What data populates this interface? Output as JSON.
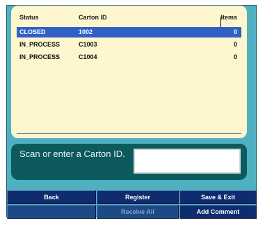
{
  "list": {
    "headers": {
      "status": "Status",
      "carton_id": "Carton ID",
      "items": "Items"
    },
    "rows": [
      {
        "status": "CLOSED",
        "carton_id": "1002",
        "items": "0",
        "selected": true
      },
      {
        "status": "IN_PROCESS",
        "carton_id": "C1003",
        "items": "0",
        "selected": false
      },
      {
        "status": "IN_PROCESS",
        "carton_id": "C1004",
        "items": "0",
        "selected": false
      }
    ]
  },
  "scan": {
    "prompt": "Scan or enter a Carton ID.",
    "value": ""
  },
  "buttons": {
    "back": "Back",
    "register": "Register",
    "save_exit": "Save & Exit",
    "receive_all": "Receive All",
    "add_comment": "Add Comment"
  },
  "colors": {
    "frame": "#4fb0c2",
    "list_background": "#fdf6cf",
    "selected_row": "#3160c5",
    "scan_panel": "#0d5a5d",
    "button": "#0f2d6e"
  }
}
